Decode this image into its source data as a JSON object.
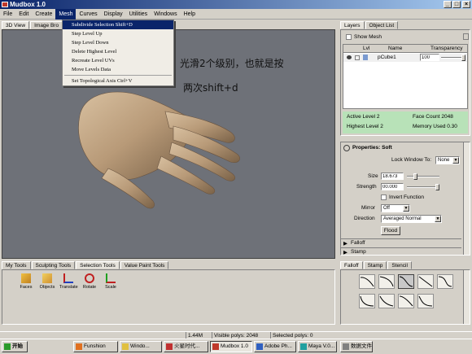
{
  "app": {
    "title": "Mudbox 1.0"
  },
  "menubar": [
    "File",
    "Edit",
    "Create",
    "Mesh",
    "Curves",
    "Display",
    "Utilities",
    "Windows",
    "Help"
  ],
  "view_tabs": [
    "3D View",
    "Image Bro"
  ],
  "mesh_menu": {
    "items": [
      {
        "label": "Subdivide Selection   Shift+D"
      },
      {
        "label": "Step Level Up"
      },
      {
        "label": "Step Level Down"
      },
      {
        "label": "Delete Highest Level"
      },
      {
        "label": "Recreate Level UVs"
      },
      {
        "label": "Move Levels Data"
      },
      {
        "label": "Set Topological Axis  Ctrl+V"
      }
    ]
  },
  "annotation": {
    "line1": "光滑2个级别，也就是按",
    "line2": "两次shift+d"
  },
  "layers_panel": {
    "tabs": [
      "Layers",
      "Object List"
    ],
    "show_mesh_label": "Show Mesh",
    "columns": [
      "",
      "Lvl",
      "Name",
      "Transparency"
    ],
    "row": {
      "level": "",
      "name": "pCube1",
      "transparency": "100"
    },
    "stats": {
      "active_level": "Active Level 2",
      "face_count": "Face Count 2048",
      "highest_level": "Highest Level 2",
      "memory_used": "Memory Used 0.30"
    }
  },
  "properties": {
    "title": "Properties: Soft",
    "lock_window_label": "Lock Window To:",
    "lock_window_value": "None",
    "size_label": "Size",
    "size_value": "18.673",
    "size_level": 0.3,
    "strength_label": "Strength",
    "strength_value": "00.000",
    "strength_level": 0.95,
    "invert_label": "Invert Function",
    "mirror_label": "Mirror",
    "mirror_value": "Off",
    "direction_label": "Direction",
    "direction_value": "Averaged Normal",
    "flood_label": "Flood",
    "falloff_section": "Falloff",
    "stamp_section": "Stamp"
  },
  "falloff_tabs": [
    "Falloff",
    "Stamp",
    "Stencil"
  ],
  "bottom_tabs": [
    "My Tools",
    "Sculpting Tools",
    "Selection Tools",
    "Value Paint Tools"
  ],
  "tools": [
    {
      "label": "Faces",
      "icon": "faces-icon"
    },
    {
      "label": "Objects",
      "icon": "objects-icon"
    },
    {
      "label": "Translate",
      "icon": "translate-icon"
    },
    {
      "label": "Rotate",
      "icon": "rotate-icon"
    },
    {
      "label": "Scale",
      "icon": "scale-icon"
    }
  ],
  "statusbar": {
    "memory": "1.44M",
    "visible_polys": "Visible polys: 2048",
    "selected_polys": "Selected polys: 0"
  },
  "taskbar": {
    "start": "开始",
    "items": [
      "Funshion",
      "Windo...",
      "火星时代...",
      "Mudbox 1.0",
      "Adobe Ph...",
      "Maya V.0..."
    ],
    "tray": "数据文件"
  },
  "colors": {
    "titlebar": "#0a246a",
    "viewport": "#6e7178",
    "green_stats": "#b8e2b8",
    "skin": "#b89a78"
  }
}
